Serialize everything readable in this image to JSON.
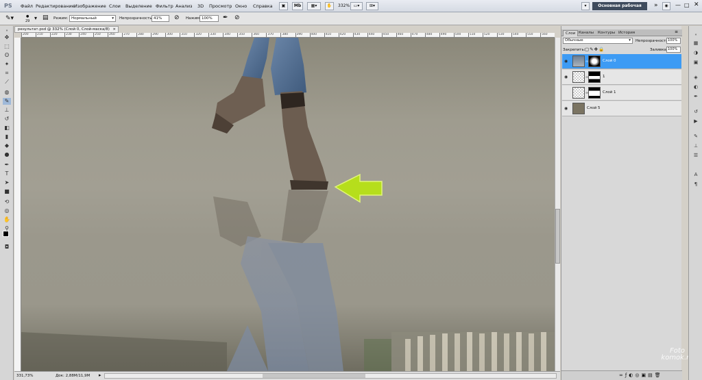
{
  "app": {
    "logo": "PS"
  },
  "menu": [
    "Файл",
    "Редактирование",
    "Изображение",
    "Слои",
    "Выделение",
    "Фильтр",
    "Анализ",
    "3D",
    "Просмотр",
    "Окно",
    "Справка"
  ],
  "menubar_tools": {
    "mb_label": "Mb",
    "zoom": "332%"
  },
  "workspace": {
    "label": "Основная рабочая среда",
    "more": "»"
  },
  "options": {
    "brush_size": "29",
    "mode_label": "Режим:",
    "mode_value": "Нормальный",
    "opacity_label": "Непрозрачность:",
    "opacity_value": "41%",
    "flow_label": "Нажим:",
    "flow_value": "100%"
  },
  "document": {
    "tab_title": "результат.psd @ 332% (Слой 0, Слой-маска/8)",
    "close": "×"
  },
  "ruler": {
    "top_ticks": [
      "200",
      "210",
      "220",
      "230",
      "240",
      "250",
      "260",
      "270",
      "280",
      "290",
      "300",
      "310",
      "320",
      "330",
      "340",
      "350",
      "360",
      "370",
      "380",
      "390",
      "400",
      "410",
      "420",
      "430",
      "440",
      "450",
      "460",
      "470",
      "480",
      "490",
      "500",
      "510",
      "520",
      "530",
      "540",
      "550",
      "560"
    ]
  },
  "status": {
    "zoom": "331,73%",
    "doc": "Док: 2,88M/11,9M"
  },
  "panel": {
    "tabs": [
      "Слои",
      "Каналы",
      "Контуры",
      "История"
    ],
    "blend_mode": "Обычные",
    "opacity_label": "Непрозрачность:",
    "opacity_value": "100%",
    "lock_label": "Закрепить:",
    "fill_label": "Заливка:",
    "fill_value": "100%",
    "layers": [
      {
        "name": "Слой 0",
        "selected": true,
        "visible": true
      },
      {
        "name": "1",
        "selected": false,
        "visible": true
      },
      {
        "name": "Слой 1",
        "selected": false,
        "visible": false
      },
      {
        "name": "Слой 5",
        "selected": false,
        "visible": true
      }
    ]
  },
  "watermark": {
    "line1": "Foto",
    "line2": "komok.ru"
  },
  "colors": {
    "arrow": "#b6de1c",
    "selected_layer": "#3d9bf4",
    "workspace_btn": "#3d4a5c"
  }
}
